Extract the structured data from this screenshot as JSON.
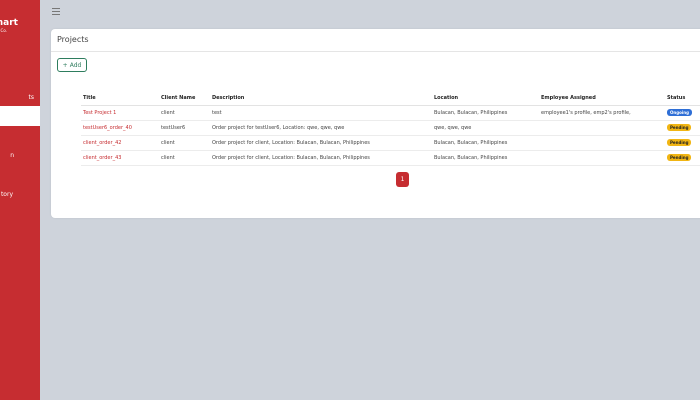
{
  "sidebar": {
    "brand": "mart",
    "brand_sub": "Co.",
    "items": [
      {
        "label": "ts"
      },
      {
        "label": "",
        "active": true
      },
      {
        "label": "n"
      },
      {
        "label": "tory"
      }
    ]
  },
  "card": {
    "title": "Projects",
    "add_label": "Add"
  },
  "table": {
    "headers": [
      "Title",
      "Client Name",
      "Description",
      "Location",
      "Employee Assigned",
      "Status"
    ],
    "rows": [
      {
        "title": "Test Project 1",
        "client": "client",
        "description": "test",
        "location": "Bulacan, Bulacan, Philippines",
        "employee": "employee1's profile, emp2's profile,",
        "status": "Ongoing"
      },
      {
        "title": "testUser6_order_40",
        "client": "testUser6",
        "description": "Order project for testUser6, Location: qwe, qwe, qwe",
        "location": "qwe, qwe, qwe",
        "employee": "",
        "status": "Pending"
      },
      {
        "title": "client_order_42",
        "client": "client",
        "description": "Order project for client, Location: Bulacan, Bulacan, Philippines",
        "location": "Bulacan, Bulacan, Philippines",
        "employee": "",
        "status": "Pending"
      },
      {
        "title": "client_order_43",
        "client": "client",
        "description": "Order project for client, Location: Bulacan, Bulacan, Philippines",
        "location": "Bulacan, Bulacan, Philippines",
        "employee": "",
        "status": "Pending"
      }
    ]
  },
  "pagination": {
    "current": "1"
  },
  "colors": {
    "brand": "#c62d31",
    "add_green": "#2e7d5e",
    "ongoing": "#2f6fd6",
    "pending": "#f1b513"
  },
  "icons": {
    "menu": "hamburger-icon",
    "add": "plus-icon"
  }
}
